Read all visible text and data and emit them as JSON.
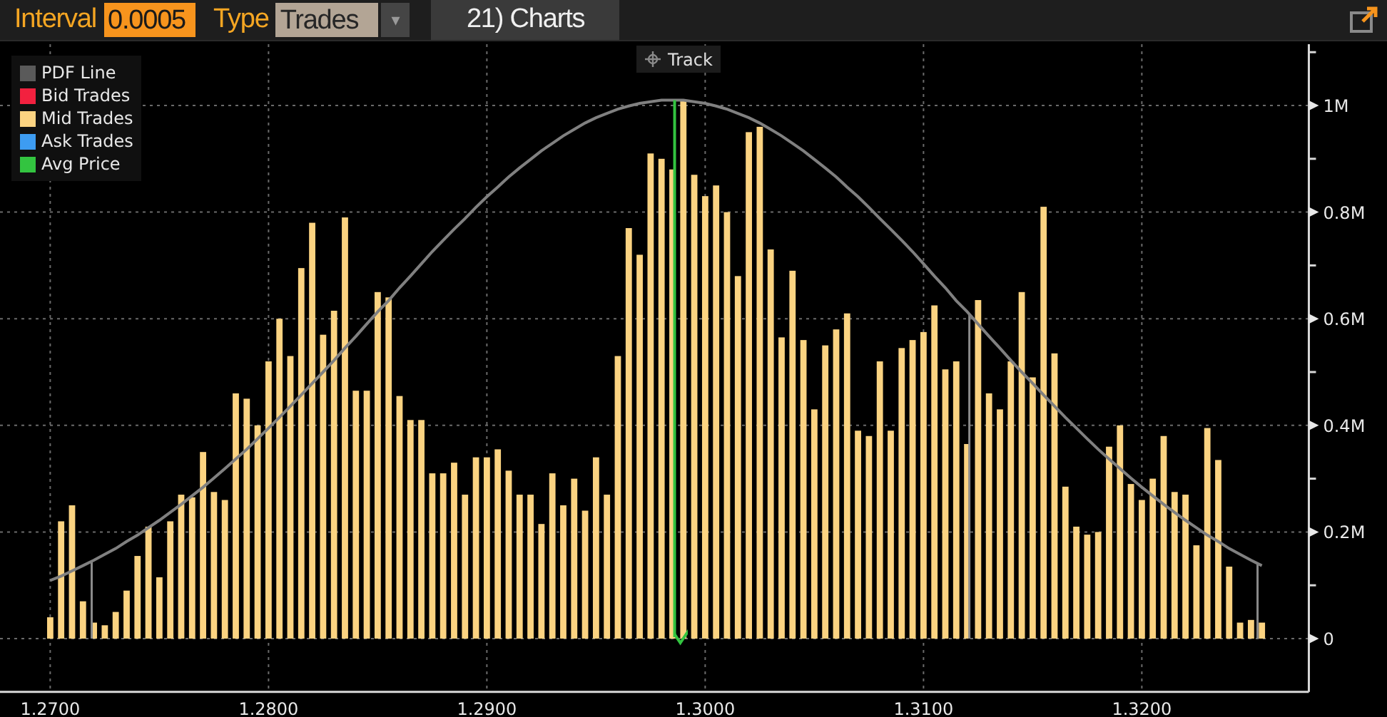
{
  "toolbar": {
    "interval_label": "Interval",
    "interval_value": "0.0005",
    "type_label": "Type",
    "type_value": "Trades",
    "dropdown_arrow": "▾",
    "charts_button": "21) Charts"
  },
  "track_button": {
    "label": "Track"
  },
  "legend": [
    {
      "kind": "series",
      "color": "#5a5a5a"
    },
    {
      "kind": "label",
      "label": "Bid Trades",
      "color": "#f2213f"
    },
    {
      "kind": "series",
      "color": "#fbd381"
    },
    {
      "kind": "label",
      "label": "Ask Trades",
      "color": "#3d9cf2"
    },
    {
      "kind": "label",
      "label": "Avg Price",
      "color": "#33c440"
    }
  ],
  "chart": {
    "chart_data": {
      "type": "bar",
      "grid": true,
      "xlim": [
        1.2677,
        1.32765
      ],
      "ylim": [
        -0.1,
        1.115
      ],
      "x": [
        1.27,
        1.2705,
        1.271,
        1.2715,
        1.272,
        1.2725,
        1.273,
        1.2735,
        1.274,
        1.2745,
        1.275,
        1.2755,
        1.276,
        1.2765,
        1.277,
        1.2775,
        1.278,
        1.2785,
        1.279,
        1.2795,
        1.28,
        1.2805,
        1.281,
        1.2815,
        1.282,
        1.2825,
        1.283,
        1.2835,
        1.284,
        1.2845,
        1.285,
        1.2855,
        1.286,
        1.2865,
        1.287,
        1.2875,
        1.288,
        1.2885,
        1.289,
        1.2895,
        1.29,
        1.2905,
        1.291,
        1.2915,
        1.292,
        1.2925,
        1.293,
        1.2935,
        1.294,
        1.2945,
        1.295,
        1.2955,
        1.296,
        1.2965,
        1.297,
        1.2975,
        1.298,
        1.2985,
        1.299,
        1.2995,
        1.3,
        1.3005,
        1.301,
        1.3015,
        1.302,
        1.3025,
        1.303,
        1.3035,
        1.304,
        1.3045,
        1.305,
        1.3055,
        1.306,
        1.3065,
        1.307,
        1.3075,
        1.308,
        1.3085,
        1.309,
        1.3095,
        1.31,
        1.3105,
        1.311,
        1.3115,
        1.312,
        1.3125,
        1.313,
        1.3135,
        1.314,
        1.3145,
        1.315,
        1.3155,
        1.316,
        1.3165,
        1.317,
        1.3175,
        1.318,
        1.3185,
        1.319,
        1.3195,
        1.32,
        1.3205,
        1.321,
        1.3215,
        1.322,
        1.3225,
        1.323,
        1.3235,
        1.324,
        1.3245,
        1.325,
        1.3255
      ],
      "series": [
        {
          "name": "Mid Trades",
          "color": "#fbd381",
          "values": [
            0.04,
            0.22,
            0.25,
            0.07,
            0.03,
            0.025,
            0.05,
            0.09,
            0.155,
            0.21,
            0.115,
            0.22,
            0.27,
            0.265,
            0.35,
            0.275,
            0.26,
            0.46,
            0.45,
            0.4,
            0.52,
            0.6,
            0.53,
            0.695,
            0.78,
            0.57,
            0.615,
            0.79,
            0.465,
            0.465,
            0.65,
            0.64,
            0.455,
            0.41,
            0.41,
            0.31,
            0.31,
            0.33,
            0.27,
            0.34,
            0.34,
            0.355,
            0.315,
            0.27,
            0.27,
            0.215,
            0.31,
            0.25,
            0.3,
            0.24,
            0.34,
            0.27,
            0.53,
            0.77,
            0.72,
            0.91,
            0.9,
            0.88,
            1.01,
            0.87,
            0.83,
            0.85,
            0.8,
            0.68,
            0.95,
            0.96,
            0.73,
            0.565,
            0.69,
            0.56,
            0.43,
            0.55,
            0.58,
            0.61,
            0.39,
            0.38,
            0.52,
            0.39,
            0.545,
            0.56,
            0.575,
            0.625,
            0.505,
            0.52,
            0.365,
            0.635,
            0.46,
            0.43,
            0.52,
            0.65,
            0.49,
            0.81,
            0.535,
            0.285,
            0.21,
            0.195,
            0.2,
            0.36,
            0.4,
            0.29,
            0.26,
            0.3,
            0.38,
            0.275,
            0.27,
            0.175,
            0.395,
            0.335,
            0.135,
            0.03,
            0.035,
            0.03
          ]
        },
        {
          "name": "PDF Line",
          "type": "line",
          "color": "#808080",
          "values": [
            0.109,
            0.117,
            0.127,
            0.137,
            0.147,
            0.158,
            0.169,
            0.182,
            0.194,
            0.208,
            0.222,
            0.237,
            0.252,
            0.268,
            0.284,
            0.301,
            0.319,
            0.337,
            0.355,
            0.375,
            0.395,
            0.415,
            0.436,
            0.457,
            0.479,
            0.5,
            0.522,
            0.545,
            0.567,
            0.59,
            0.613,
            0.634,
            0.658,
            0.68,
            0.703,
            0.726,
            0.747,
            0.768,
            0.788,
            0.809,
            0.829,
            0.847,
            0.866,
            0.883,
            0.899,
            0.915,
            0.929,
            0.943,
            0.955,
            0.967,
            0.977,
            0.985,
            0.993,
            0.999,
            1.004,
            1.007,
            1.01,
            1.01,
            1.01,
            1.007,
            1.004,
            0.999,
            0.993,
            0.985,
            0.977,
            0.967,
            0.955,
            0.943,
            0.929,
            0.915,
            0.899,
            0.883,
            0.866,
            0.847,
            0.829,
            0.809,
            0.788,
            0.768,
            0.747,
            0.726,
            0.703,
            0.68,
            0.658,
            0.634,
            0.613,
            0.59,
            0.567,
            0.545,
            0.522,
            0.5,
            0.479,
            0.457,
            0.436,
            0.415,
            0.395,
            0.375,
            0.355,
            0.337,
            0.319,
            0.301,
            0.284,
            0.268,
            0.252,
            0.237,
            0.222,
            0.208,
            0.194,
            0.182,
            0.169,
            0.158,
            0.147,
            0.137
          ]
        }
      ],
      "xticks": [
        {
          "value": 1.27,
          "label": "1.2700"
        },
        {
          "value": 1.28,
          "label": "1.2800"
        },
        {
          "value": 1.29,
          "label": "1.2900"
        },
        {
          "value": 1.3,
          "label": "1.3000"
        },
        {
          "value": 1.31,
          "label": "1.3100"
        },
        {
          "value": 1.32,
          "label": "1.3200"
        }
      ],
      "yticks": [
        {
          "value": 0,
          "label": "0"
        },
        {
          "value": 0.2,
          "label": "0.2M"
        },
        {
          "value": 0.4,
          "label": "0.4M"
        },
        {
          "value": 0.6,
          "label": "0.6M"
        },
        {
          "value": 0.8,
          "label": "0.8M"
        },
        {
          "value": 1,
          "label": "1M"
        }
      ],
      "ref_lines": [
        {
          "axis": "x",
          "value": 1.2986,
          "color": "#33c440"
        },
        {
          "axis": "x",
          "value": 1.2719,
          "color": "#8a8a8a"
        },
        {
          "axis": "x",
          "value": 1.3121,
          "color": "#8a8a8a"
        },
        {
          "axis": "x",
          "value": 1.3253,
          "color": "#8a8a8a"
        }
      ]
    }
  }
}
